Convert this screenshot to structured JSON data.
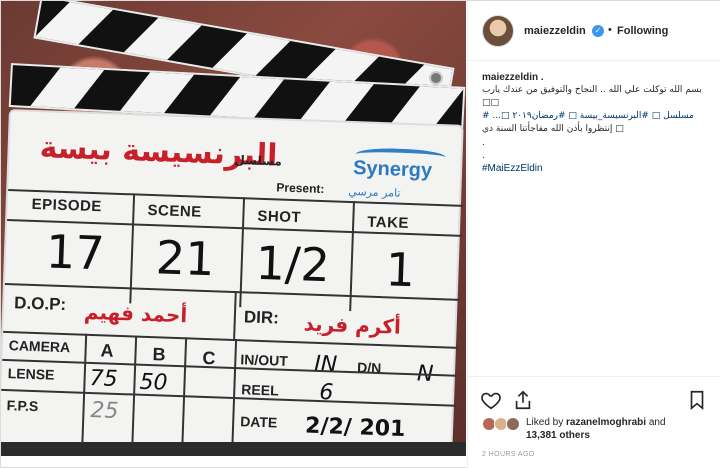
{
  "post": {
    "username": "maiezzeldin",
    "verified_glyph": "✓",
    "separator": "•",
    "follow_status": "Following"
  },
  "caption": {
    "user": "maiezzeldin .",
    "line1": "بسم الله توكلت علي الله .. النجاح والتوفيق من عندك يارب",
    "line2": "□□",
    "line3": "مسلسل □ #البرنسيسة_بيسة □ #رمضان٢٠١٩ □... #",
    "line4": "□ إنتظروا بأذن الله مفاجأتنا السنة دي",
    "dot1": ".",
    "dot2": ".",
    "hashtag": "#MaiEzzEldin"
  },
  "likes": {
    "prefix": "Liked by ",
    "liker": "razanelmoghrabi",
    "middle": " and",
    "count": "13,381 others"
  },
  "timestamp": "2 HOURS AGO",
  "board": {
    "title_ar": "البرنسيسة بيسة",
    "series_ar": "مسلسل",
    "logo": "Synergy",
    "present_label": "Present:",
    "presenter_ar": "تامر مرسي",
    "headers": [
      "EPISODE",
      "SCENE",
      "SHOT",
      "TAKE"
    ],
    "values": [
      "17",
      "21",
      "1/2",
      "1"
    ],
    "dop_label": "D.O.P:",
    "dop_ar": "أحمد فهيم",
    "dir_label": "DIR:",
    "dir_ar": "أكرم فريد",
    "camera_label": "CAMERA",
    "cams": [
      "A",
      "B",
      "C"
    ],
    "inout_label": "IN/OUT",
    "inout_val": "IN",
    "dn_label": "D/N",
    "dn_val": "N",
    "lense_label": "LENSE",
    "lense_vals": [
      "75",
      "50"
    ],
    "reel_label": "REEL",
    "reel_val": "6",
    "fps_label": "F.P.S",
    "fps_val": "25",
    "date_label": "DATE",
    "date_val": "2/2/ 201"
  },
  "icons": {
    "heart": "heart-icon",
    "share": "share-icon",
    "bookmark": "bookmark-icon"
  },
  "colors": {
    "link": "#003569",
    "verified": "#3897f0",
    "board_red": "#c8202a",
    "synergy_blue": "#2b7ac0"
  }
}
